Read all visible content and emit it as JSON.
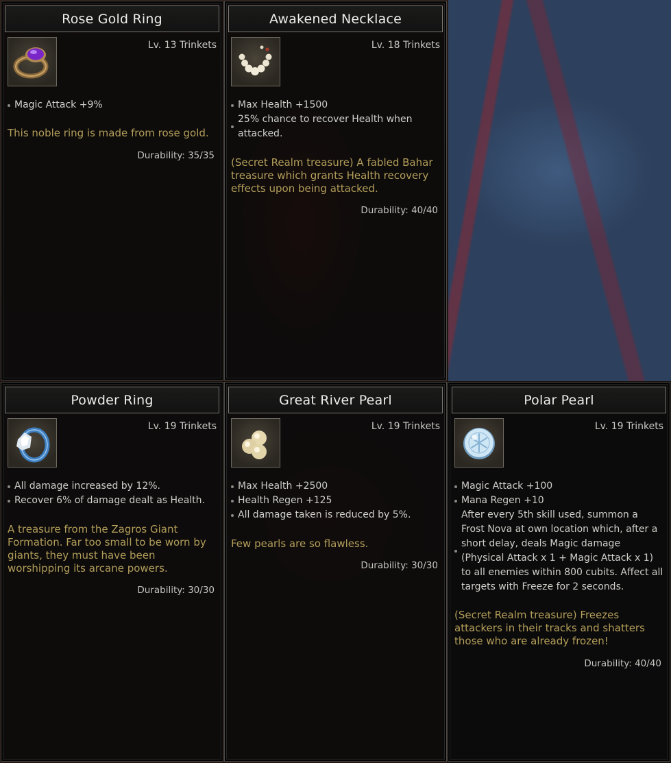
{
  "cards": [
    {
      "name": "Rose Gold Ring",
      "level": "Lv. 13 Trinkets",
      "icon": "rose-gold-ring-icon",
      "stats": [
        "Magic Attack +9%"
      ],
      "flavor": "This noble ring is made from rose gold.",
      "durability": "Durability: 35/35"
    },
    {
      "name": "Awakened Necklace",
      "level": "Lv. 18 Trinkets",
      "icon": "pearl-necklace-icon",
      "stats": [
        "Max Health +1500",
        "25% chance to recover Health when attacked."
      ],
      "flavor": "(Secret Realm treasure) A fabled Bahar treasure which grants Health recovery effects upon being attacked.",
      "durability": "Durability: 40/40"
    },
    {
      "name": "Powder Ring",
      "level": "Lv. 19 Trinkets",
      "icon": "powder-ring-icon",
      "stats": [
        "All damage increased by 12%.",
        "Recover 6% of damage dealt as Health."
      ],
      "flavor": "A treasure from the Zagros Giant Formation. Far too small to be worn by giants, they must have been worshipping its arcane powers.",
      "durability": "Durability: 30/30"
    },
    {
      "name": "Great River Pearl",
      "level": "Lv. 19 Trinkets",
      "icon": "pearls-icon",
      "stats": [
        "Max Health +2500",
        "Health Regen +125",
        "All damage taken is reduced by 5%."
      ],
      "flavor": "Few pearls are so flawless.",
      "durability": "Durability: 30/30"
    },
    {
      "name": "Polar Pearl",
      "level": "Lv. 19 Trinkets",
      "icon": "polar-pearl-icon",
      "stats": [
        "Magic Attack +100",
        "Mana Regen +10",
        "After every 5th skill used, summon a Frost Nova at own location which, after a short delay, deals Magic damage (Physical Attack x 1 + Magic Attack x 1) to all enemies within 800 cubits. Affect all targets with Freeze for 2 seconds."
      ],
      "flavor": "(Secret Realm treasure) Freezes attackers in their tracks and shatters those who are already frozen!",
      "durability": "Durability: 40/40"
    }
  ],
  "colors": {
    "flavor_text": "#b39e5a",
    "title_text": "#ededea",
    "card_border": "#7a7a74"
  }
}
